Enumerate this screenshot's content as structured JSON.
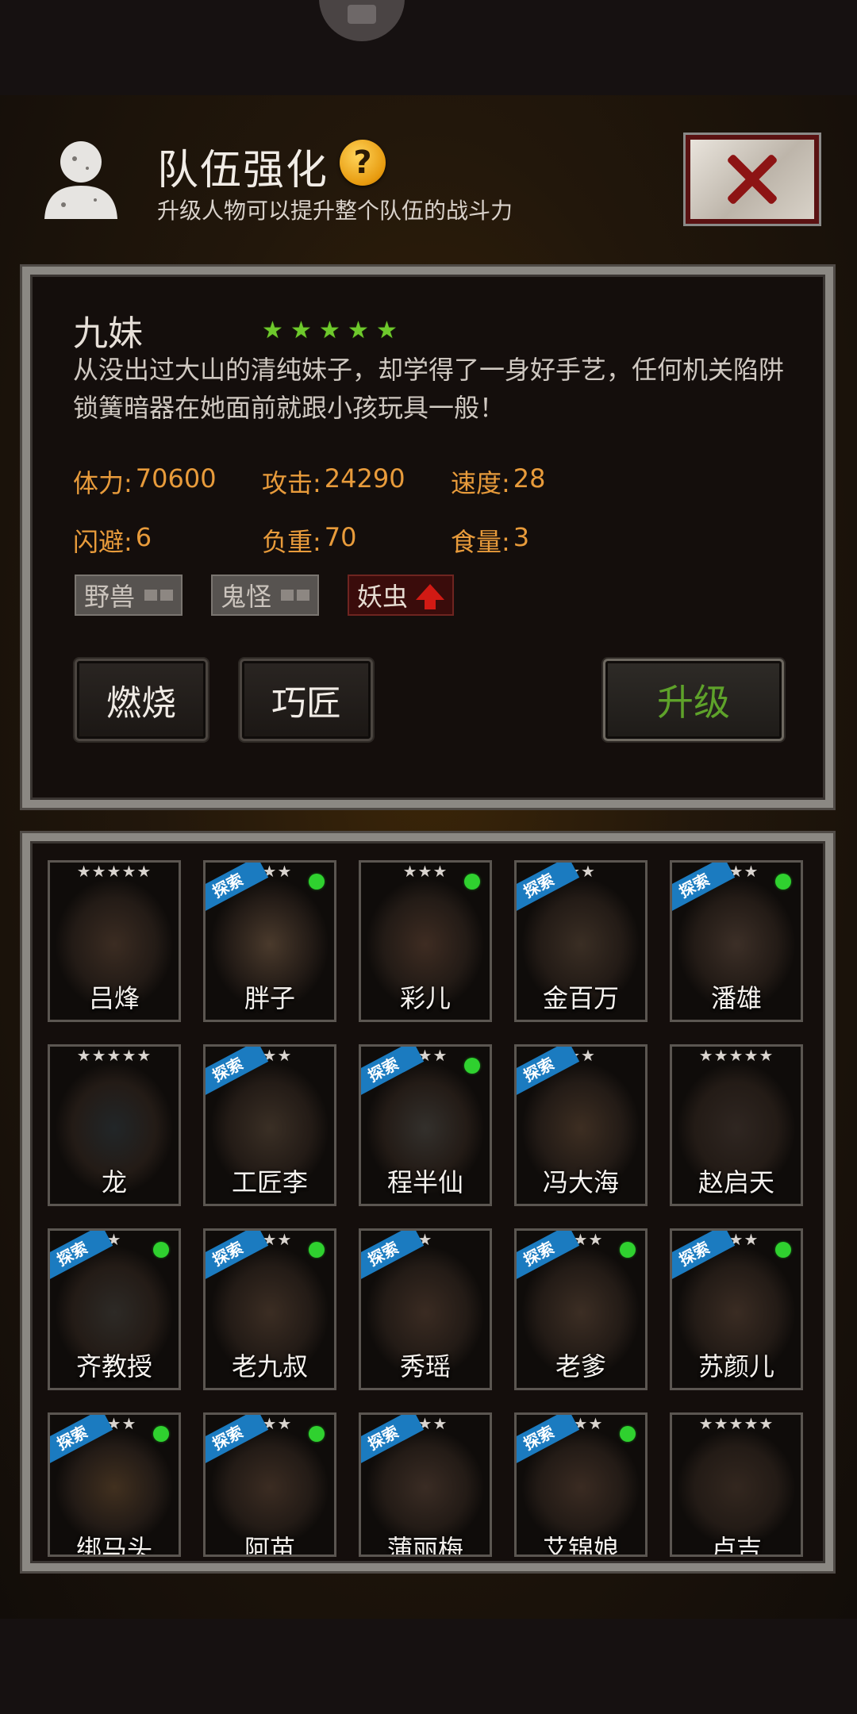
{
  "header": {
    "title": "队伍强化",
    "subtitle": "升级人物可以提升整个队伍的战斗力",
    "help_glyph": "?"
  },
  "character": {
    "name": "九妹",
    "stars": 5,
    "star_glyph": "★",
    "description": "从没出过大山的清纯妹子，却学得了一身好手艺，任何机关陷阱锁簧暗器在她面前就跟小孩玩具一般！",
    "stats": [
      {
        "label": "体力:",
        "value": "70600"
      },
      {
        "label": "攻击:",
        "value": "24290"
      },
      {
        "label": "速度:",
        "value": "28"
      },
      {
        "label": "闪避:",
        "value": "6"
      },
      {
        "label": "负重:",
        "value": "70"
      },
      {
        "label": "食量:",
        "value": "3"
      }
    ],
    "tags": [
      {
        "label": "野兽",
        "state": "neutral"
      },
      {
        "label": "鬼怪",
        "state": "neutral"
      },
      {
        "label": "妖虫",
        "state": "up"
      }
    ]
  },
  "buttons": {
    "burn": "燃烧",
    "craft": "巧匠",
    "upgrade": "升级"
  },
  "roster": [
    {
      "name": "吕烽",
      "stars": "★★★★★",
      "explore": false,
      "online": false,
      "tone": "#3b2c22"
    },
    {
      "name": "胖子",
      "stars": "★★★",
      "explore": true,
      "online": true,
      "tone": "#4a3a2c"
    },
    {
      "name": "彩儿",
      "stars": "★★★",
      "explore": false,
      "online": true,
      "tone": "#3e2c22"
    },
    {
      "name": "金百万",
      "stars": "★★",
      "explore": true,
      "online": false,
      "tone": "#3a2e24"
    },
    {
      "name": "潘雄",
      "stars": "★★★",
      "explore": true,
      "online": true,
      "tone": "#3c2f27"
    },
    {
      "name": "龙",
      "stars": "★★★★★",
      "explore": false,
      "online": false,
      "tone": "#222628"
    },
    {
      "name": "工匠李",
      "stars": "★★★",
      "explore": true,
      "online": false,
      "tone": "#3a2f25"
    },
    {
      "name": "程半仙",
      "stars": "★★★",
      "explore": true,
      "online": true,
      "tone": "#33302c"
    },
    {
      "name": "冯大海",
      "stars": "★★",
      "explore": true,
      "online": false,
      "tone": "#3d2e22"
    },
    {
      "name": "赵启天",
      "stars": "★★★★★",
      "explore": false,
      "online": false,
      "tone": "#2f2621"
    },
    {
      "name": "齐教授",
      "stars": "★",
      "explore": true,
      "online": true,
      "tone": "#2d2a26"
    },
    {
      "name": "老九叔",
      "stars": "★★★",
      "explore": true,
      "online": true,
      "tone": "#3b2d23"
    },
    {
      "name": "秀瑶",
      "stars": "★",
      "explore": true,
      "online": false,
      "tone": "#3a2b22"
    },
    {
      "name": "老爹",
      "stars": "★★★",
      "explore": true,
      "online": true,
      "tone": "#3c2e24"
    },
    {
      "name": "苏颜儿",
      "stars": "★★★",
      "explore": true,
      "online": true,
      "tone": "#3a2c23"
    },
    {
      "name": "绑马头",
      "stars": "★★★",
      "explore": true,
      "online": true,
      "tone": "#41301f"
    },
    {
      "name": "阿苗",
      "stars": "★★★",
      "explore": true,
      "online": true,
      "tone": "#3b2c22"
    },
    {
      "name": "蒲丽梅",
      "stars": "★★★",
      "explore": true,
      "online": false,
      "tone": "#3a2c24"
    },
    {
      "name": "艾锦娘",
      "stars": "★★★",
      "explore": true,
      "online": true,
      "tone": "#3a2b22"
    },
    {
      "name": "卢吉",
      "stars": "★★★★★",
      "explore": false,
      "online": false,
      "tone": "#33271f"
    }
  ],
  "labels": {
    "explore": "探索"
  },
  "colors": {
    "stat_text": "#e89b3b",
    "star_green": "#6ec92c",
    "upgrade_text": "#5ea22a",
    "explore_blue": "#1b7bc0",
    "online_green": "#2fd12f"
  }
}
